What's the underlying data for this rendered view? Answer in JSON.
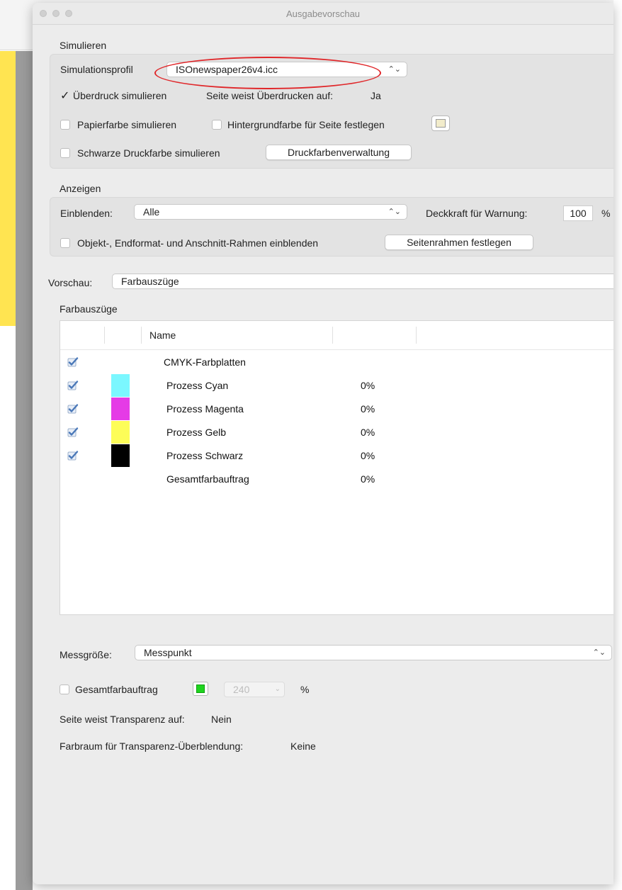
{
  "window": {
    "title": "Ausgabevorschau"
  },
  "simulieren": {
    "section_label": "Simulieren",
    "profile_label": "Simulationsprofil",
    "profile_value": "ISOnewspaper26v4.icc",
    "overprint_checked": true,
    "overprint_label": "Überdruck simulieren",
    "overprint_info_label": "Seite weist Überdrucken auf:",
    "overprint_info_value": "Ja",
    "paper_label": "Papierfarbe simulieren",
    "background_label": "Hintergrundfarbe für Seite festlegen",
    "background_color": "#f2eccb",
    "black_ink_label": "Schwarze Druckfarbe simulieren",
    "ink_manager_button": "Druckfarbenverwaltung"
  },
  "anzeigen": {
    "section_label": "Anzeigen",
    "show_label": "Einblenden:",
    "show_value": "Alle",
    "opacity_label": "Deckkraft für Warnung:",
    "opacity_value": "100",
    "opacity_unit": "%",
    "frames_label": "Objekt-, Endformat- und Anschnitt-Rahmen einblenden",
    "page_boxes_button": "Seitenrahmen festlegen"
  },
  "preview": {
    "label": "Vorschau:",
    "value": "Farbauszüge"
  },
  "separations": {
    "section_label": "Farbauszüge",
    "column_name": "Name",
    "rows": [
      {
        "checked": true,
        "swatch": null,
        "name": "CMYK-Farbplatten",
        "pct": ""
      },
      {
        "checked": true,
        "swatch": "#7bf7ff",
        "name": "Prozess Cyan",
        "pct": "0%"
      },
      {
        "checked": true,
        "swatch": "#e53be6",
        "name": "Prozess Magenta",
        "pct": "0%"
      },
      {
        "checked": true,
        "swatch": "#fdfd58",
        "name": "Prozess Gelb",
        "pct": "0%"
      },
      {
        "checked": true,
        "swatch": "#000000",
        "name": "Prozess Schwarz",
        "pct": "0%"
      },
      {
        "checked": false,
        "swatch": null,
        "name": "Gesamtfarbauftrag",
        "pct": "0%"
      }
    ]
  },
  "bottom": {
    "sample_label": "Messgröße:",
    "sample_value": "Messpunkt",
    "total_label": "Gesamtfarbauftrag",
    "total_color": "#1fd41f",
    "total_value": "240",
    "total_unit": "%",
    "transparency_label": "Seite weist Transparenz auf:",
    "transparency_value": "Nein",
    "blend_label": "Farbraum für Transparenz-Überblendung:",
    "blend_value": "Keine"
  },
  "colors": {
    "highlight_oval": "#e0272a",
    "accent_yellow": "#ffe451"
  }
}
